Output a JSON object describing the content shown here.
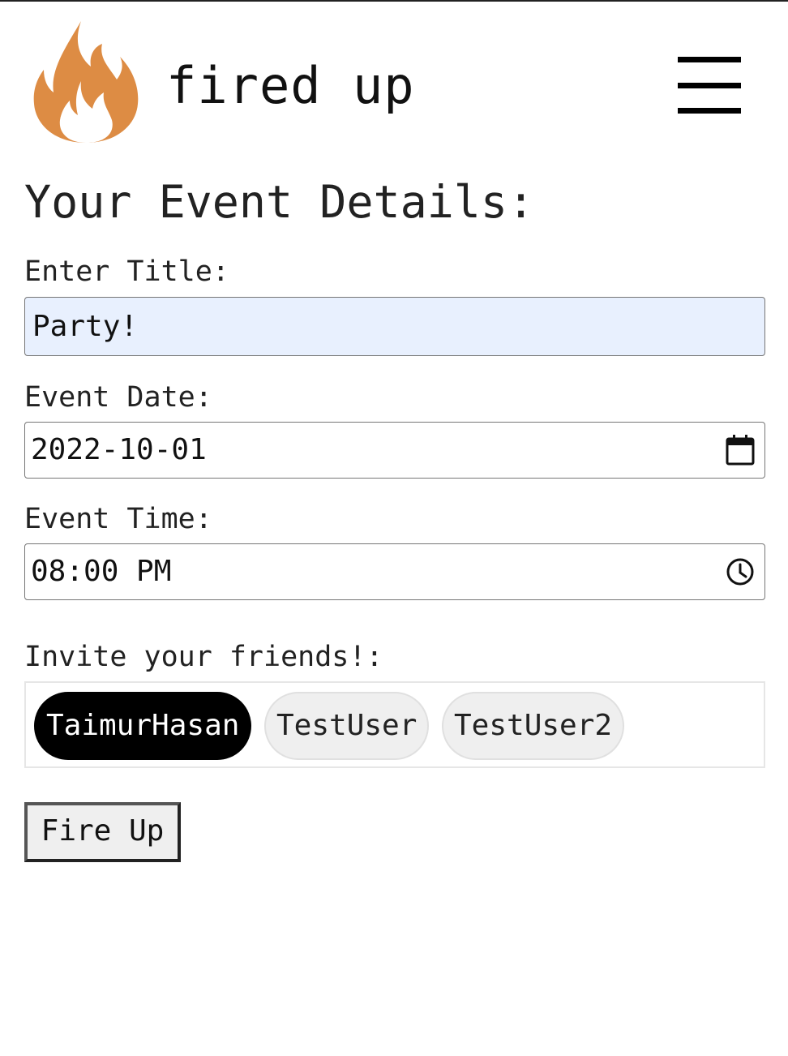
{
  "colors": {
    "brand_flame": "#dd8c44",
    "title_field_bg": "#e8f0fe",
    "chip_selected_bg": "#000000",
    "chip_default_bg": "#efefef"
  },
  "header": {
    "logo_icon": "flame-icon",
    "brand": "fired up",
    "menu_icon": "hamburger-menu-icon"
  },
  "page": {
    "title": "Your Event Details:"
  },
  "form": {
    "title_label": "Enter Title:",
    "title_value": "Party!",
    "date_label": "Event Date:",
    "date_value": "2022-10-01",
    "date_icon": "calendar-icon",
    "time_label": "Event Time:",
    "time_value": "08:00 PM",
    "time_icon": "clock-icon",
    "friends_label": "Invite your friends!:",
    "friends": [
      {
        "name": "TaimurHasan",
        "selected": true
      },
      {
        "name": "TestUser",
        "selected": false
      },
      {
        "name": "TestUser2",
        "selected": false
      }
    ],
    "submit_label": "Fire Up"
  }
}
